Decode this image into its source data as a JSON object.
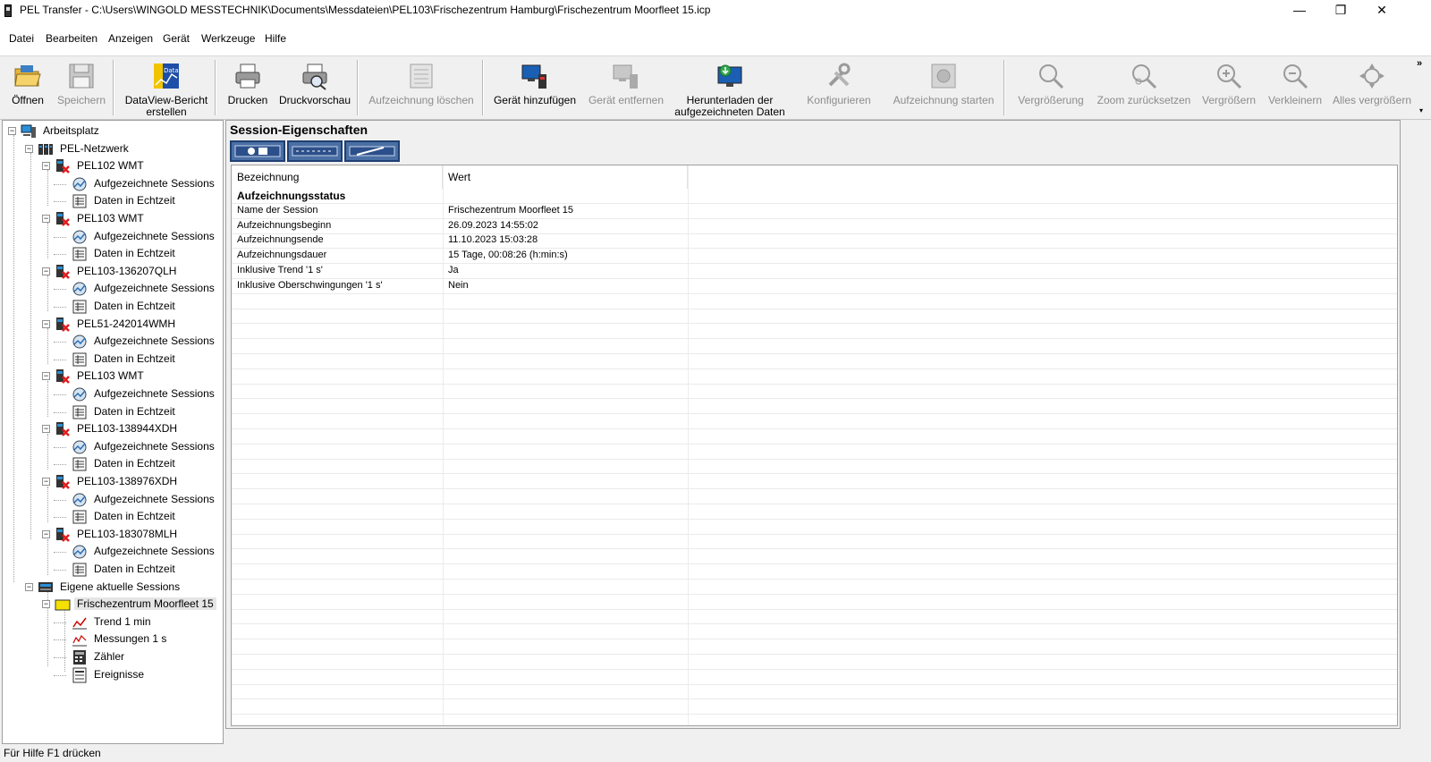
{
  "window": {
    "title": "PEL Transfer - C:\\Users\\WINGOLD MESSTECHNIK\\Documents\\Messdateien\\PEL103\\Frischezentrum Hamburg\\Frischezentrum Moorfleet 15.icp",
    "minimize": "—",
    "maximize": "❐",
    "close": "✕"
  },
  "menu": [
    "Datei",
    "Bearbeiten",
    "Anzeigen",
    "Gerät",
    "Werkzeuge",
    "Hilfe"
  ],
  "toolbar": {
    "items": [
      {
        "label": "Öffnen",
        "icon": "folder-open-icon",
        "enabled": true
      },
      {
        "label": "Speichern",
        "icon": "floppy-disk-icon",
        "enabled": false
      },
      {
        "label": "DataView-Bericht\nerstellen",
        "icon": "dataview-icon",
        "enabled": true
      },
      {
        "label": "Drucken",
        "icon": "printer-icon",
        "enabled": true
      },
      {
        "label": "Druckvorschau",
        "icon": "print-preview-icon",
        "enabled": true
      },
      {
        "label": "Aufzeichnung löschen",
        "icon": "delete-recording-icon",
        "enabled": false
      },
      {
        "label": "Gerät hinzufügen",
        "icon": "add-device-icon",
        "enabled": true
      },
      {
        "label": "Gerät entfernen",
        "icon": "remove-device-icon",
        "enabled": false
      },
      {
        "label": "Herunterladen der\naufgezeichneten Daten",
        "icon": "download-data-icon",
        "enabled": true
      },
      {
        "label": "Konfigurieren",
        "icon": "tools-icon",
        "enabled": false
      },
      {
        "label": "Aufzeichnung starten",
        "icon": "start-recording-icon",
        "enabled": false
      },
      {
        "label": "Vergrößerung",
        "icon": "magnifier-icon",
        "enabled": false
      },
      {
        "label": "Zoom zurücksetzen",
        "icon": "zoom-reset-icon",
        "enabled": false
      },
      {
        "label": "Vergrößern",
        "icon": "zoom-in-icon",
        "enabled": false
      },
      {
        "label": "Verkleinern",
        "icon": "zoom-out-icon",
        "enabled": false
      },
      {
        "label": "Alles vergrößern",
        "icon": "zoom-all-icon",
        "enabled": false
      }
    ],
    "overflow": "»",
    "dropdown": "▾"
  },
  "tree": {
    "root": "Arbeitsplatz",
    "network": "PEL-Netzwerk",
    "devices": [
      {
        "name": "PEL102 WMT",
        "children": [
          "Aufgezeichnete Sessions",
          "Daten in Echtzeit"
        ]
      },
      {
        "name": "PEL103 WMT",
        "children": [
          "Aufgezeichnete Sessions",
          "Daten in Echtzeit"
        ]
      },
      {
        "name": "PEL103-136207QLH",
        "children": [
          "Aufgezeichnete Sessions",
          "Daten in Echtzeit"
        ]
      },
      {
        "name": "PEL51-242014WMH",
        "children": [
          "Aufgezeichnete Sessions",
          "Daten in Echtzeit"
        ]
      },
      {
        "name": "PEL103 WMT",
        "children": [
          "Aufgezeichnete Sessions",
          "Daten in Echtzeit"
        ]
      },
      {
        "name": "PEL103-138944XDH",
        "children": [
          "Aufgezeichnete Sessions",
          "Daten in Echtzeit"
        ]
      },
      {
        "name": "PEL103-138976XDH",
        "children": [
          "Aufgezeichnete Sessions",
          "Daten in Echtzeit"
        ]
      },
      {
        "name": "PEL103-183078MLH",
        "children": [
          "Aufgezeichnete Sessions",
          "Daten in Echtzeit"
        ]
      }
    ],
    "sessions_group": "Eigene aktuelle Sessions",
    "session": "Frischezentrum Moorfleet 15",
    "session_children": [
      "Trend 1 min",
      "Messungen 1 s",
      "Zähler",
      "Ereignisse"
    ],
    "toggle_minus": "−"
  },
  "panel": {
    "title": "Session-Eigenschaften",
    "columns": [
      "Bezeichnung",
      "Wert"
    ],
    "section": "Aufzeichnungsstatus",
    "rows": [
      [
        "Name der Session",
        "Frischezentrum Moorfleet 15"
      ],
      [
        "Aufzeichnungsbeginn",
        "26.09.2023 14:55:02"
      ],
      [
        "Aufzeichnungsende",
        "11.10.2023 15:03:28"
      ],
      [
        "Aufzeichnungsdauer",
        "15 Tage, 00:08:26 (h:min:s)"
      ],
      [
        "Inklusive Trend '1 s'",
        "Ja"
      ],
      [
        "Inklusive Oberschwingungen '1 s'",
        "Nein"
      ]
    ]
  },
  "status": "Für Hilfe F1 drücken"
}
